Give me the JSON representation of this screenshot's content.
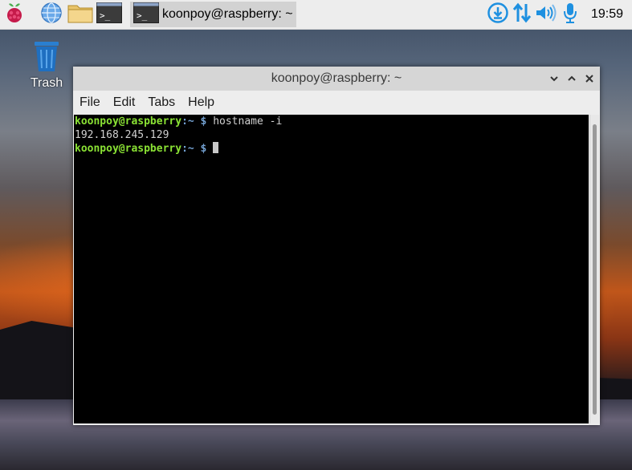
{
  "panel": {
    "task_title": "koonpoy@raspberry: ~",
    "clock": "19:59",
    "icons": [
      "raspberry-menu-icon",
      "web-browser-icon",
      "file-manager-icon",
      "terminal-icon",
      "download-icon",
      "network-icon",
      "volume-icon",
      "microphone-icon"
    ],
    "accent": "#1e90e0"
  },
  "desktop": {
    "trash_label": "Trash"
  },
  "window": {
    "title": "koonpoy@raspberry: ~",
    "menu": {
      "file": "File",
      "edit": "Edit",
      "tabs": "Tabs",
      "help": "Help"
    }
  },
  "terminal": {
    "line1": {
      "user": "koonpoy@raspberry",
      "path": ":~",
      "prompt": " $ ",
      "command": "hostname -i"
    },
    "line2": "192.168.245.129",
    "line3": {
      "user": "koonpoy@raspberry",
      "path": ":~",
      "prompt": " $ "
    }
  },
  "colors": {
    "prompt_user": "#8ae234",
    "prompt_path": "#729fcf"
  }
}
